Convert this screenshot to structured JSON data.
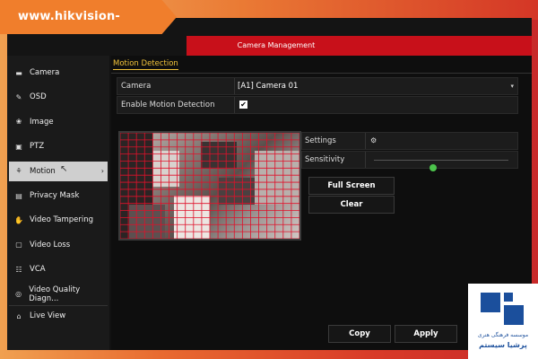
{
  "watermark": {
    "url": "www.hikvision-cctv.com"
  },
  "header": {
    "title": "Camera Management"
  },
  "sidebar": {
    "items": [
      {
        "label": "Camera",
        "icon": "camera-icon",
        "glyph": "▬"
      },
      {
        "label": "OSD",
        "icon": "pen-icon",
        "glyph": "✎"
      },
      {
        "label": "Image",
        "icon": "image-icon",
        "glyph": "❀"
      },
      {
        "label": "PTZ",
        "icon": "ptz-icon",
        "glyph": "▣"
      },
      {
        "label": "Motion",
        "icon": "motion-icon",
        "glyph": "⚘",
        "active": true,
        "chevron": "›"
      },
      {
        "label": "Privacy Mask",
        "icon": "mask-icon",
        "glyph": "▤"
      },
      {
        "label": "Video Tampering",
        "icon": "hand-icon",
        "glyph": "✋"
      },
      {
        "label": "Video Loss",
        "icon": "video-loss-icon",
        "glyph": "▢"
      },
      {
        "label": "VCA",
        "icon": "vca-icon",
        "glyph": "☷"
      },
      {
        "label": "Video Quality Diagn...",
        "icon": "diagnosis-icon",
        "glyph": "◎"
      }
    ],
    "live_view": {
      "label": "Live View",
      "icon": "home-icon",
      "glyph": "⌂"
    }
  },
  "tab": {
    "label": "Motion Detection"
  },
  "form": {
    "camera_label": "Camera",
    "camera_value": "[A1] Camera 01",
    "dropdown_glyph": "▾",
    "enable_label": "Enable Motion Detection",
    "enable_checked": true,
    "check_glyph": "✔"
  },
  "settings": {
    "settings_label": "Settings",
    "gear_glyph": "⚙",
    "sensitivity_label": "Sensitivity",
    "sensitivity_level": 0.44
  },
  "buttons": {
    "full_screen": "Full Screen",
    "clear": "Clear",
    "copy": "Copy",
    "apply": "Apply"
  },
  "colors": {
    "accent_red": "#c8101a",
    "tab_yellow": "#f0c23a",
    "grid_red": "#e0102a",
    "slider_green": "#4cc34c",
    "logo_blue": "#1b4f9c"
  },
  "grid": {
    "cols": 22,
    "rows": 15
  },
  "logo": {
    "line1": "موسسه فرهنگی هنری",
    "line2": "پرشیا سیستم"
  }
}
